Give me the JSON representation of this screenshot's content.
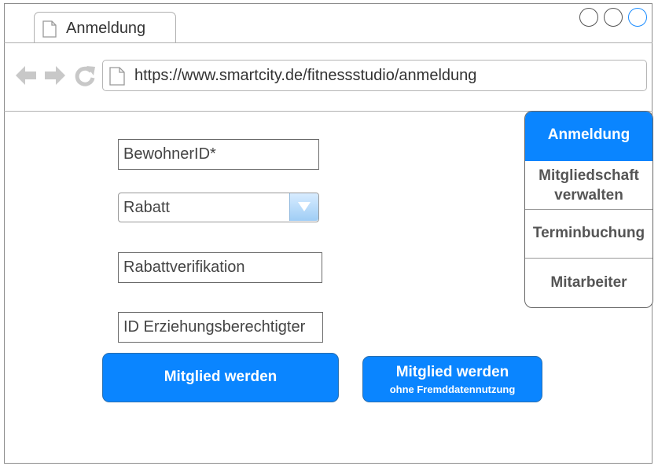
{
  "browser": {
    "tab_title": "Anmeldung",
    "url": "https://www.smartcity.de/fitnessstudio/anmeldung",
    "icons": {
      "back": "back-arrow-icon",
      "forward": "forward-arrow-icon",
      "reload": "reload-icon",
      "page": "page-icon"
    }
  },
  "form": {
    "bewohner_id_placeholder": "BewohnerID*",
    "rabatt_selected": "Rabatt",
    "rabattverifikation_placeholder": "Rabattverifikation",
    "erziehungsberechtigter_placeholder": "ID Erziehungsberechtigter"
  },
  "buttons": {
    "mitglied_werden": "Mitglied werden",
    "mitglied_werden_ohne_line1": "Mitglied werden",
    "mitglied_werden_ohne_line2": "ohne Fremddatennutzung"
  },
  "sidenav": {
    "items": [
      {
        "label": "Anmeldung",
        "active": true
      },
      {
        "label_line1": "Mitgliedschaft",
        "label_line2": "verwalten"
      },
      {
        "label": "Terminbuchung"
      },
      {
        "label": "Mitarbeiter"
      }
    ]
  },
  "colors": {
    "accent": "#0a85ff",
    "border": "#6b6b6b"
  }
}
